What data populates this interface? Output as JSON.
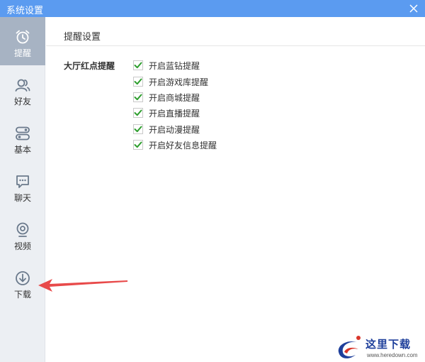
{
  "window": {
    "title": "系统设置",
    "close_icon": "close-icon"
  },
  "sidebar": {
    "items": [
      {
        "label": "提醒",
        "icon": "alarm-clock-icon",
        "active": true
      },
      {
        "label": "好友",
        "icon": "friends-icon",
        "active": false
      },
      {
        "label": "基本",
        "icon": "toggle-switch-icon",
        "active": false
      },
      {
        "label": "聊天",
        "icon": "chat-bubble-icon",
        "active": false
      },
      {
        "label": "视频",
        "icon": "webcam-icon",
        "active": false
      },
      {
        "label": "下载",
        "icon": "download-icon",
        "active": false
      }
    ]
  },
  "main": {
    "section_title": "提醒设置",
    "group_label": "大厅红点提醒",
    "options": [
      {
        "label": "开启蓝钻提醒",
        "checked": true
      },
      {
        "label": "开启游戏库提醒",
        "checked": true
      },
      {
        "label": "开启商城提醒",
        "checked": true
      },
      {
        "label": "开启直播提醒",
        "checked": true
      },
      {
        "label": "开启动漫提醒",
        "checked": true
      },
      {
        "label": "开启好友信息提醒",
        "checked": true
      }
    ]
  },
  "watermark": {
    "text": "这里下载",
    "url": "www.heredown.com"
  },
  "colors": {
    "titlebar": "#5b9bf0",
    "sidebar": "#eceff3",
    "sidebar_active": "#a7b3c3",
    "check": "#2e9e2e",
    "annotation_arrow": "#e84a4a"
  }
}
